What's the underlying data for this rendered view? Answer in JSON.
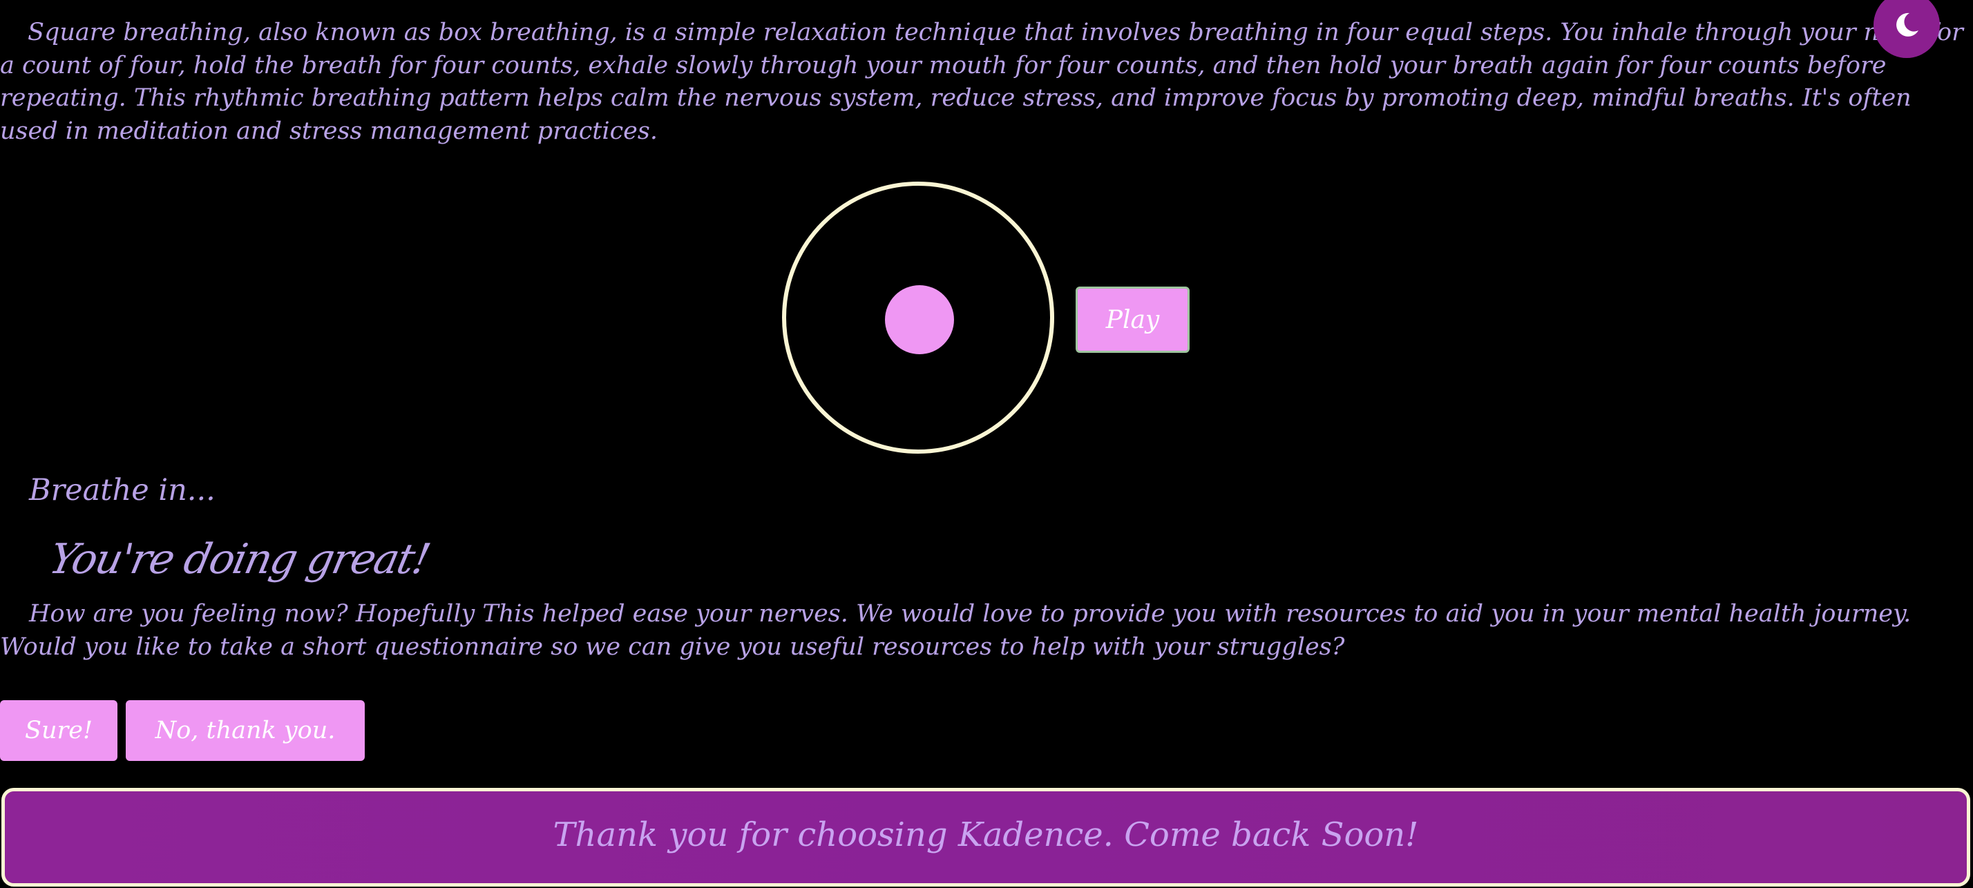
{
  "colors": {
    "background": "#000000",
    "text": "#b8a2e6",
    "accent_pink": "#ef97f3",
    "ring": "#fbf6d4",
    "footer_purple": "#8e2497",
    "toggle_purple": "#8b1f8f"
  },
  "theme_toggle": {
    "icon": "moon-icon"
  },
  "intro": {
    "text": "Square breathing, also known as box breathing, is a simple relaxation technique that involves breathing in four equal steps. You inhale through your nose for a count of four, hold the breath for four counts, exhale slowly through your mouth for four counts, and then hold your breath again for four counts before repeating. This rhythmic breathing pattern helps calm the nervous system, reduce stress, and improve focus by promoting deep, mindful breaths. It's often used in meditation and stress management practices."
  },
  "exercise": {
    "play_label": "Play",
    "status": "Breathe in..."
  },
  "encouragement": "You're doing great!",
  "followup": {
    "text": "How are you feeling now? Hopefully This helped ease your nerves. We would love to provide you with resources to aid you in your mental health journey. Would you like to take a short questionnaire so we can give you useful resources to help with your struggles?",
    "yes_label": "Sure!",
    "no_label": "No, thank you."
  },
  "footer": {
    "text": "Thank you for choosing Kadence. Come back Soon!"
  }
}
